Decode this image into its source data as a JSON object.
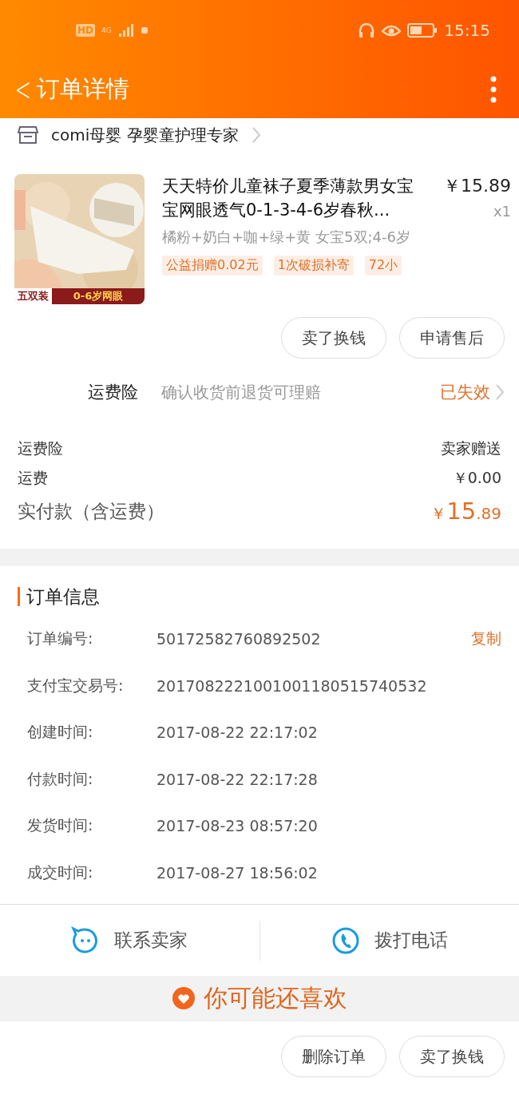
{
  "status_bar": {
    "hd": "HD",
    "network": "4G",
    "time": "15:15"
  },
  "header": {
    "back": "<",
    "title": "订单详情"
  },
  "shop": {
    "name": "comi母婴 孕婴童护理专家"
  },
  "product": {
    "image_banner": [
      "五双装",
      "0-6岁网眼"
    ],
    "title": "天天特价儿童袜子夏季薄款男女宝宝网眼透气0-1-3-4-6岁春秋...",
    "price": "￥15.89",
    "quantity": "x1",
    "sku": "橘粉+奶白+咖+绿+黄 女宝5双;4-6岁",
    "tags": [
      "公益捐赠0.02元",
      "1次破损补寄",
      "72小"
    ]
  },
  "item_actions": [
    "卖了换钱",
    "申请售后"
  ],
  "insurance": {
    "label": "运费险",
    "description": "确认收货前退货可理赔",
    "status": "已失效"
  },
  "fees": [
    {
      "label": "运费险",
      "value": "卖家赠送"
    },
    {
      "label": "运费",
      "value": "￥0.00"
    }
  ],
  "total": {
    "label": "实付款（含运费）",
    "currency": "￥",
    "integer": "15",
    "decimal": ".89"
  },
  "order_info": {
    "title": "订单信息",
    "rows": [
      {
        "label": "订单编号:",
        "value": "50172582760892502",
        "action": "复制"
      },
      {
        "label": "支付宝交易号:",
        "value": "2017082221001001180515740532"
      },
      {
        "label": "创建时间:",
        "value": "2017-08-22 22:17:02"
      },
      {
        "label": "付款时间:",
        "value": "2017-08-22 22:17:28"
      },
      {
        "label": "发货时间:",
        "value": "2017-08-23 08:57:20"
      },
      {
        "label": "成交时间:",
        "value": "2017-08-27 18:56:02"
      }
    ]
  },
  "contact": [
    {
      "kind": "chat",
      "label": "联系卖家"
    },
    {
      "kind": "phone",
      "label": "拨打电话"
    }
  ],
  "recommend": {
    "title": "你可能还喜欢"
  },
  "footer_actions": [
    "删除订单",
    "卖了换钱"
  ]
}
